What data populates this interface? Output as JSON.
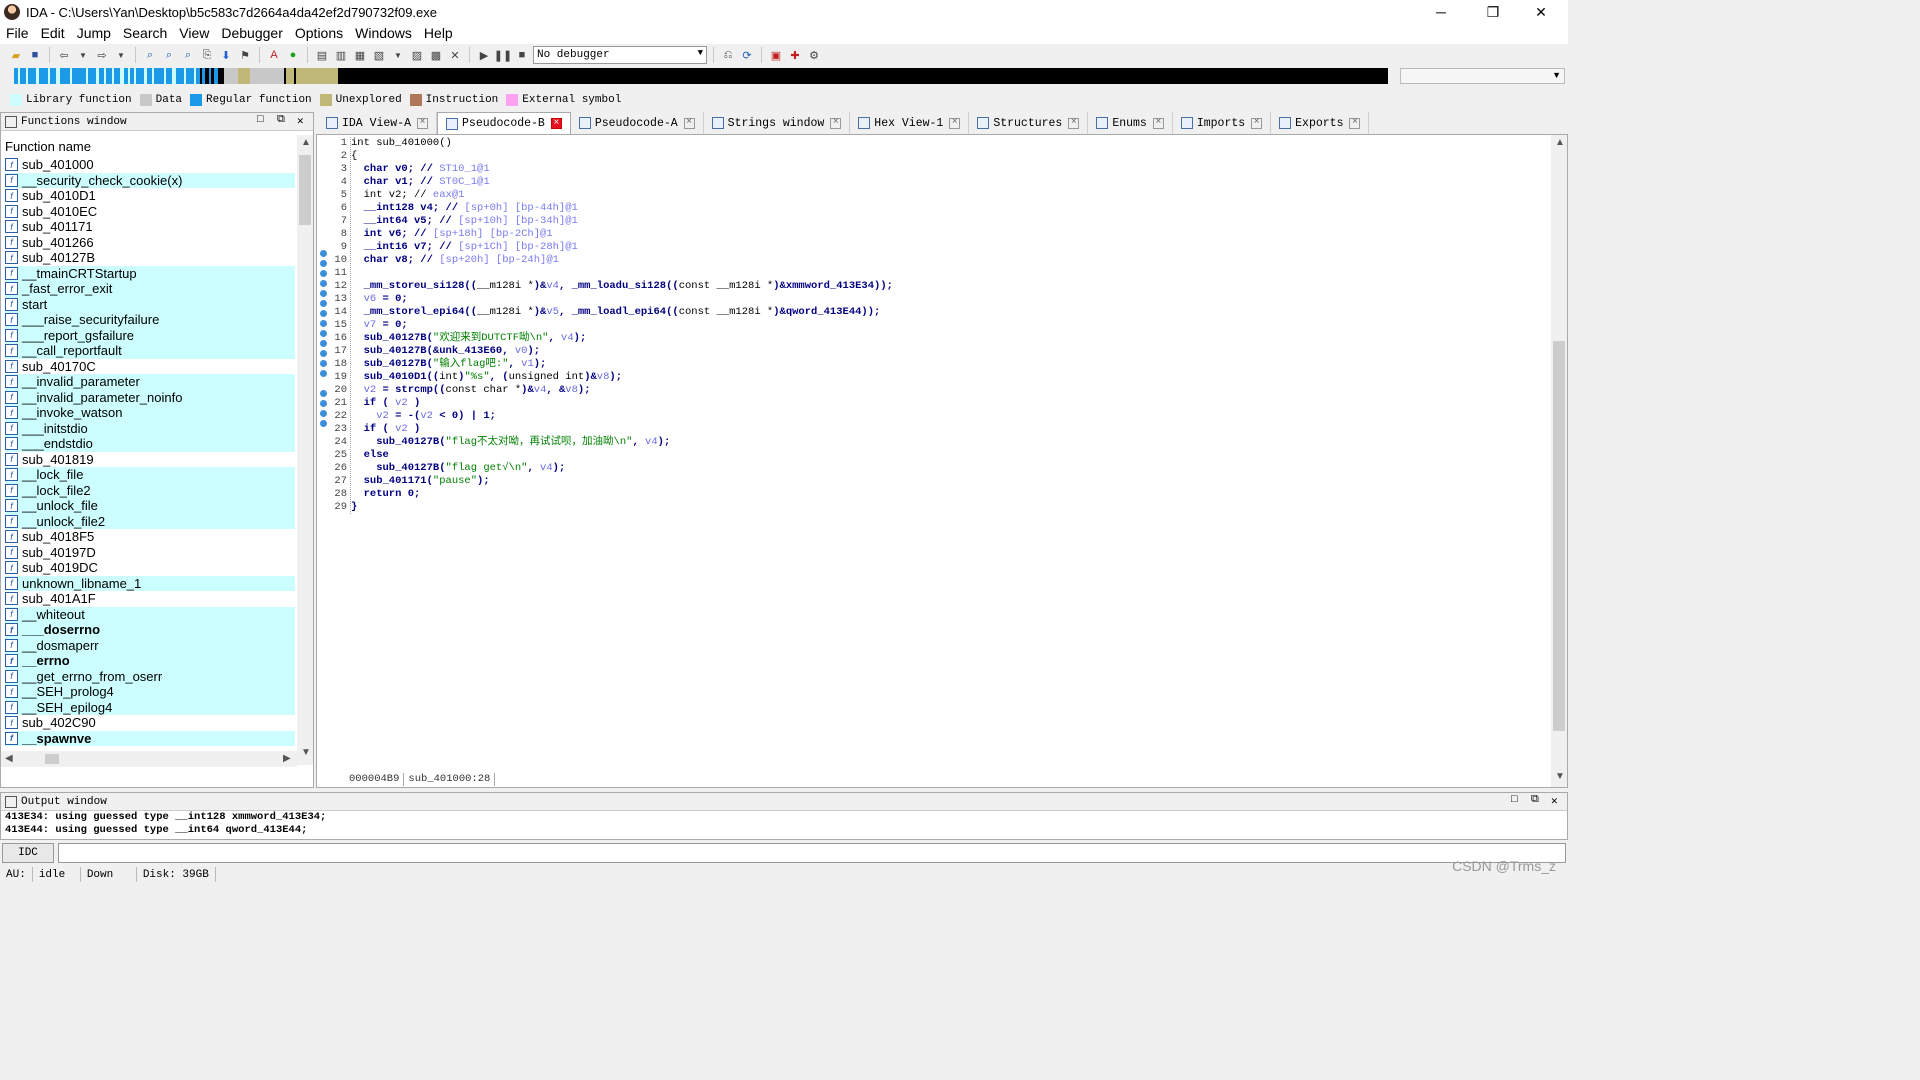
{
  "title": "IDA - C:\\Users\\Yan\\Desktop\\b5c583c7d2664a4da42ef2d790732f09.exe",
  "window_controls": {
    "minimize": "─",
    "restore": "❐",
    "close": "✕"
  },
  "menu": [
    "File",
    "Edit",
    "Jump",
    "Search",
    "View",
    "Debugger",
    "Options",
    "Windows",
    "Help"
  ],
  "toolbar": {
    "debugger": "No debugger"
  },
  "legend": [
    {
      "label": "Library function",
      "color": "#ccfeff"
    },
    {
      "label": "Data",
      "color": "#c8c8c8"
    },
    {
      "label": "Regular function",
      "color": "#1c9ae8"
    },
    {
      "label": "Unexplored",
      "color": "#c0b878"
    },
    {
      "label": "Instruction",
      "color": "#b0785a"
    },
    {
      "label": "External symbol",
      "color": "#ffa0f0"
    }
  ],
  "functions_window": {
    "title": "Functions window",
    "column": "Function name",
    "items": [
      {
        "name": "sub_401000",
        "lib": false,
        "bold": false
      },
      {
        "name": "__security_check_cookie(x)",
        "lib": true,
        "bold": false
      },
      {
        "name": "sub_4010D1",
        "lib": false,
        "bold": false
      },
      {
        "name": "sub_4010EC",
        "lib": false,
        "bold": false
      },
      {
        "name": "sub_401171",
        "lib": false,
        "bold": false
      },
      {
        "name": "sub_401266",
        "lib": false,
        "bold": false
      },
      {
        "name": "sub_40127B",
        "lib": false,
        "bold": false
      },
      {
        "name": "__tmainCRTStartup",
        "lib": true,
        "bold": false
      },
      {
        "name": "_fast_error_exit",
        "lib": true,
        "bold": false
      },
      {
        "name": "start",
        "lib": true,
        "bold": false
      },
      {
        "name": "___raise_securityfailure",
        "lib": true,
        "bold": false
      },
      {
        "name": "___report_gsfailure",
        "lib": true,
        "bold": false
      },
      {
        "name": "__call_reportfault",
        "lib": true,
        "bold": false
      },
      {
        "name": "sub_40170C",
        "lib": false,
        "bold": false
      },
      {
        "name": "__invalid_parameter",
        "lib": true,
        "bold": false
      },
      {
        "name": "__invalid_parameter_noinfo",
        "lib": true,
        "bold": false
      },
      {
        "name": "__invoke_watson",
        "lib": true,
        "bold": false
      },
      {
        "name": "___initstdio",
        "lib": true,
        "bold": false
      },
      {
        "name": "___endstdio",
        "lib": true,
        "bold": false
      },
      {
        "name": "sub_401819",
        "lib": false,
        "bold": false
      },
      {
        "name": "__lock_file",
        "lib": true,
        "bold": false
      },
      {
        "name": "__lock_file2",
        "lib": true,
        "bold": false
      },
      {
        "name": "__unlock_file",
        "lib": true,
        "bold": false
      },
      {
        "name": "__unlock_file2",
        "lib": true,
        "bold": false
      },
      {
        "name": "sub_4018F5",
        "lib": false,
        "bold": false
      },
      {
        "name": "sub_40197D",
        "lib": false,
        "bold": false
      },
      {
        "name": "sub_4019DC",
        "lib": false,
        "bold": false
      },
      {
        "name": "unknown_libname_1",
        "lib": true,
        "bold": false
      },
      {
        "name": "sub_401A1F",
        "lib": false,
        "bold": false
      },
      {
        "name": "__whiteout",
        "lib": true,
        "bold": false
      },
      {
        "name": "___doserrno",
        "lib": true,
        "bold": true
      },
      {
        "name": "__dosmaperr",
        "lib": true,
        "bold": false
      },
      {
        "name": "__errno",
        "lib": true,
        "bold": true
      },
      {
        "name": "__get_errno_from_oserr",
        "lib": true,
        "bold": false
      },
      {
        "name": "__SEH_prolog4",
        "lib": true,
        "bold": false
      },
      {
        "name": "__SEH_epilog4",
        "lib": true,
        "bold": false
      },
      {
        "name": "sub_402C90",
        "lib": false,
        "bold": false
      },
      {
        "name": "__spawnve",
        "lib": true,
        "bold": true
      }
    ]
  },
  "tabs": [
    {
      "label": "IDA View-A",
      "active": false
    },
    {
      "label": "Pseudocode-B",
      "active": true
    },
    {
      "label": "Pseudocode-A",
      "active": false
    },
    {
      "label": "Strings window",
      "active": false
    },
    {
      "label": "Hex View-1",
      "active": false
    },
    {
      "label": "Structures",
      "active": false
    },
    {
      "label": "Enums",
      "active": false
    },
    {
      "label": "Imports",
      "active": false
    },
    {
      "label": "Exports",
      "active": false
    }
  ],
  "code": {
    "lines": [
      {
        "n": "1",
        "dot": false,
        "segs": [
          [
            "n",
            "int sub_401000()"
          ]
        ]
      },
      {
        "n": "2",
        "dot": false,
        "segs": [
          [
            "n",
            "{"
          ]
        ]
      },
      {
        "n": "3",
        "dot": false,
        "segs": [
          [
            "k",
            "  char v0; // "
          ],
          [
            "c",
            "ST10_1@1"
          ]
        ]
      },
      {
        "n": "4",
        "dot": false,
        "segs": [
          [
            "k",
            "  char v1; // "
          ],
          [
            "c",
            "ST0C_1@1"
          ]
        ]
      },
      {
        "n": "5",
        "dot": false,
        "segs": [
          [
            "n",
            "  int v2; // "
          ],
          [
            "c",
            "eax@1"
          ]
        ]
      },
      {
        "n": "6",
        "dot": false,
        "segs": [
          [
            "k",
            "  __int128 v4; // "
          ],
          [
            "c",
            "[sp+0h] [bp-44h]@1"
          ]
        ]
      },
      {
        "n": "7",
        "dot": false,
        "segs": [
          [
            "k",
            "  __int64 v5; // "
          ],
          [
            "c",
            "[sp+10h] [bp-34h]@1"
          ]
        ]
      },
      {
        "n": "8",
        "dot": false,
        "segs": [
          [
            "k",
            "  int v6; // "
          ],
          [
            "c",
            "[sp+18h] [bp-2Ch]@1"
          ]
        ]
      },
      {
        "n": "9",
        "dot": false,
        "segs": [
          [
            "k",
            "  __int16 v7; // "
          ],
          [
            "c",
            "[sp+1Ch] [bp-28h]@1"
          ]
        ]
      },
      {
        "n": "10",
        "dot": false,
        "segs": [
          [
            "k",
            "  char v8; // "
          ],
          [
            "c",
            "[sp+20h] [bp-24h]@1"
          ]
        ]
      },
      {
        "n": "11",
        "dot": false,
        "segs": [
          [
            "n",
            ""
          ]
        ]
      },
      {
        "n": "12",
        "dot": true,
        "segs": [
          [
            "k",
            "  _mm_storeu_si128(("
          ],
          [
            "n",
            "__m128i *"
          ],
          [
            "k",
            ")&"
          ],
          [
            "v",
            "v4"
          ],
          [
            "k",
            ", _mm_loadu_si128(("
          ],
          [
            "n",
            "const __m128i *"
          ],
          [
            "k",
            ")&xmmword_413E34));"
          ]
        ]
      },
      {
        "n": "13",
        "dot": true,
        "segs": [
          [
            "v",
            "  v6"
          ],
          [
            "k",
            " = 0;"
          ]
        ]
      },
      {
        "n": "14",
        "dot": true,
        "segs": [
          [
            "k",
            "  _mm_storel_epi64(("
          ],
          [
            "n",
            "__m128i *"
          ],
          [
            "k",
            ")&"
          ],
          [
            "v",
            "v5"
          ],
          [
            "k",
            ", _mm_loadl_epi64(("
          ],
          [
            "n",
            "const __m128i *"
          ],
          [
            "k",
            ")&qword_413E44));"
          ]
        ]
      },
      {
        "n": "15",
        "dot": true,
        "segs": [
          [
            "v",
            "  v7"
          ],
          [
            "k",
            " = 0;"
          ]
        ]
      },
      {
        "n": "16",
        "dot": true,
        "segs": [
          [
            "k",
            "  sub_40127B("
          ],
          [
            "s",
            "\"欢迎来到DUTCTF呦\\n\""
          ],
          [
            "k",
            ", "
          ],
          [
            "v",
            "v4"
          ],
          [
            "k",
            ");"
          ]
        ]
      },
      {
        "n": "17",
        "dot": true,
        "segs": [
          [
            "k",
            "  sub_40127B(&unk_413E60, "
          ],
          [
            "v",
            "v0"
          ],
          [
            "k",
            ");"
          ]
        ]
      },
      {
        "n": "18",
        "dot": true,
        "segs": [
          [
            "k",
            "  sub_40127B("
          ],
          [
            "s",
            "\"输入flag吧:\""
          ],
          [
            "k",
            ", "
          ],
          [
            "v",
            "v1"
          ],
          [
            "k",
            ");"
          ]
        ]
      },
      {
        "n": "19",
        "dot": true,
        "segs": [
          [
            "k",
            "  sub_4010D1(("
          ],
          [
            "n",
            "int"
          ],
          [
            "k",
            ")"
          ],
          [
            "s",
            "\"%s\""
          ],
          [
            "k",
            ", ("
          ],
          [
            "n",
            "unsigned int"
          ],
          [
            "k",
            ")&"
          ],
          [
            "v",
            "v8"
          ],
          [
            "k",
            ");"
          ]
        ]
      },
      {
        "n": "20",
        "dot": true,
        "segs": [
          [
            "v",
            "  v2"
          ],
          [
            "k",
            " = strcmp(("
          ],
          [
            "n",
            "const char *"
          ],
          [
            "k",
            ")&"
          ],
          [
            "v",
            "v4"
          ],
          [
            "k",
            ", &"
          ],
          [
            "v",
            "v8"
          ],
          [
            "k",
            ");"
          ]
        ]
      },
      {
        "n": "21",
        "dot": true,
        "segs": [
          [
            "k",
            "  if ( "
          ],
          [
            "v",
            "v2"
          ],
          [
            "k",
            " )"
          ]
        ]
      },
      {
        "n": "22",
        "dot": true,
        "segs": [
          [
            "v",
            "    v2"
          ],
          [
            "k",
            " = -("
          ],
          [
            "v",
            "v2"
          ],
          [
            "k",
            " < 0) | 1;"
          ]
        ]
      },
      {
        "n": "23",
        "dot": true,
        "segs": [
          [
            "k",
            "  if ( "
          ],
          [
            "v",
            "v2"
          ],
          [
            "k",
            " )"
          ]
        ]
      },
      {
        "n": "24",
        "dot": true,
        "segs": [
          [
            "k",
            "    sub_40127B("
          ],
          [
            "s",
            "\"flag不太对呦，再试试呗，加油呦\\n\""
          ],
          [
            "k",
            ", "
          ],
          [
            "v",
            "v4"
          ],
          [
            "k",
            ");"
          ]
        ]
      },
      {
        "n": "25",
        "dot": false,
        "segs": [
          [
            "k",
            "  else"
          ]
        ]
      },
      {
        "n": "26",
        "dot": true,
        "segs": [
          [
            "k",
            "    sub_40127B("
          ],
          [
            "s",
            "\"flag get√\\n\""
          ],
          [
            "k",
            ", "
          ],
          [
            "v",
            "v4"
          ],
          [
            "k",
            ");"
          ]
        ]
      },
      {
        "n": "27",
        "dot": true,
        "segs": [
          [
            "k",
            "  sub_401171("
          ],
          [
            "s",
            "\"pause\""
          ],
          [
            "k",
            ");"
          ]
        ]
      },
      {
        "n": "28",
        "dot": true,
        "segs": [
          [
            "k",
            "  return 0;"
          ]
        ]
      },
      {
        "n": "29",
        "dot": true,
        "segs": [
          [
            "k",
            "}"
          ]
        ]
      }
    ],
    "status": {
      "address": "000004B9",
      "location": "sub_401000:28"
    }
  },
  "output_window": {
    "title": "Output window",
    "lines": [
      "413E34: using guessed type __int128 xmmword_413E34;",
      "413E44: using guessed type __int64 qword_413E44;"
    ]
  },
  "command": {
    "lang": "IDC"
  },
  "statusbar": {
    "au_label": "AU:",
    "au": "idle",
    "dir": "Down",
    "disk": "Disk: 39GB"
  },
  "watermark": "CSDN @Trms_z"
}
